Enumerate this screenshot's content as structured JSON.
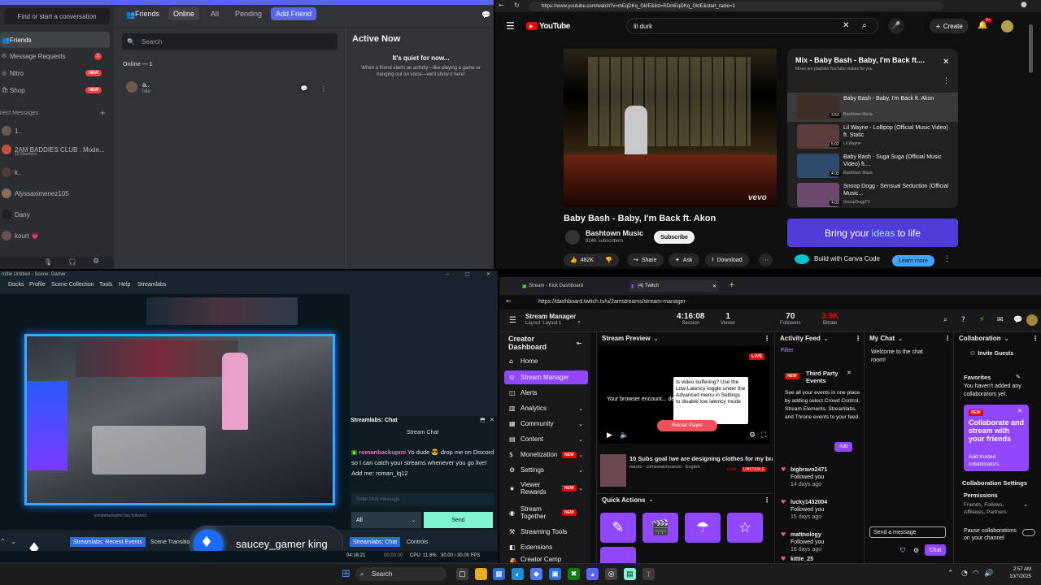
{
  "discord": {
    "find_placeholder": "Find or start a conversation",
    "nav": [
      {
        "label": "Friends"
      },
      {
        "label": "Message Requests",
        "badge": "1"
      },
      {
        "label": "Nitro",
        "badge": "NEW"
      },
      {
        "label": "Shop",
        "badge": "NEW"
      }
    ],
    "dm_header": "irect Messages",
    "dms": [
      {
        "name": "1..",
        "sub": ""
      },
      {
        "name": "2AM BADDIES CLUB . Mode...",
        "sub": "10 Members"
      },
      {
        "name": "k..",
        "sub": ""
      },
      {
        "name": "Alyssaximenez105",
        "sub": ""
      },
      {
        "name": "Dany",
        "sub": ""
      },
      {
        "name": "kourt 💗",
        "sub": ""
      }
    ],
    "tabs": {
      "friends": "Friends",
      "online": "Online",
      "all": "All",
      "pending": "Pending",
      "add": "Add Friend"
    },
    "search_placeholder": "Search",
    "online_count": "Online — 1",
    "friend": {
      "name": "a..",
      "status": "Idle"
    },
    "active_now": {
      "title": "Active Now",
      "quiet": "It's quiet for now...",
      "desc": "When a friend starts an activity—like playing a game or hanging out on voice—we'll show it here!"
    }
  },
  "youtube": {
    "url": "https://www.youtube.com/watch?v=mEqDKq_GkIE&list=RDmEqDKq_GkIE&start_radio=1",
    "logo": "YouTube",
    "search_value": "lil durk",
    "create_label": "Create",
    "notif_count": "9+",
    "video_title": "Baby Bash - Baby, I'm Back ft. Akon",
    "vevo": "vevo",
    "channel": "Bashtown Music",
    "subscribers": "824K subscribers",
    "subscribe": "Subscribe",
    "likes": "482K",
    "share": "Share",
    "ask": "Ask",
    "download": "Download",
    "playlist": {
      "title": "Mix - Baby Bash - Baby, I'm Back ft....",
      "subtitle": "Mixes are playlists YouTube makes for you",
      "items": [
        {
          "title": "Baby Bash - Baby, I'm Back ft. Akon",
          "channel": "Bashtown Music",
          "duration": "3:53"
        },
        {
          "title": "Lil Wayne - Lollipop (Official Music Video) ft. Static",
          "channel": "Lil Wayne",
          "duration": "5:02"
        },
        {
          "title": "Baby Bash - Suga Suga (Official Music Video) ft....",
          "channel": "Bashtown Music",
          "duration": "4:03"
        },
        {
          "title": "Snoop Dogg - Sensual Seduction (Official Music...",
          "channel": "SnoopDoggTV",
          "duration": "4:03"
        }
      ]
    },
    "ad": {
      "text_a": "Bring your ",
      "text_b": "ideas",
      "text_c": " to life",
      "sub": "Build with Canva Code",
      "cta": "Learn more"
    }
  },
  "streamlabs": {
    "title": "rofile Untitled - Scene: Gamer",
    "menu": [
      "Docks",
      "Profile",
      "Scene Collection",
      "Tools",
      "Help",
      "Streamlabs"
    ],
    "chat_title": "Streamlabs: Chat",
    "chat_sub": "Stream Chat",
    "chat_user": "romanbackupmi",
    "chat_msg": "Yo dude 😎 drop me on Discord so I can catch your streams whenever you go live! Add me: roman_lq12",
    "chat_placeholder": "Enter chat message",
    "chat_select": "All",
    "send": "Send",
    "bottom_tabs": [
      "Streamlabs: Recent Events",
      "Scene Transitio",
      "Streamlabs: Chat",
      "Controls"
    ],
    "overlay_name": "saucey_gamer king",
    "status": {
      "time": "04:16:21",
      "rec": "00:00:00",
      "cpu": "CPU: 11.8%",
      "fps": "30.00 / 30.00 FPS"
    },
    "recent_event": "romanbackupmi has followed"
  },
  "twitch": {
    "tabs": [
      {
        "label": "Stream - Kick Dashboard"
      },
      {
        "label": "(4) Twitch"
      }
    ],
    "url": "https://dashboard.twitch.tv/u/2amstreams/stream-manager",
    "page": "Stream Manager",
    "layout": "Layout: Layout 1",
    "stats": [
      {
        "value": "4:16:08",
        "label": "Session"
      },
      {
        "value": "1",
        "label": "Viewer"
      },
      {
        "value": "70",
        "label": "Followers"
      },
      {
        "value": "3.9K",
        "label": "Bitrate"
      }
    ],
    "sidebar_title": "Creator Dashboard",
    "nav": [
      {
        "label": "Home",
        "chev": false,
        "new": false
      },
      {
        "label": "Stream Manager",
        "chev": false,
        "new": false
      },
      {
        "label": "Alerts",
        "chev": false,
        "new": false
      },
      {
        "label": "Analytics",
        "chev": true,
        "new": false
      },
      {
        "label": "Community",
        "chev": true,
        "new": false
      },
      {
        "label": "Content",
        "chev": true,
        "new": false
      },
      {
        "label": "Monetization",
        "chev": true,
        "new": true
      },
      {
        "label": "Settings",
        "chev": true,
        "new": false
      },
      {
        "label": "Viewer Rewards",
        "chev": true,
        "new": true
      },
      {
        "label": "Stream Together",
        "chev": false,
        "new": true
      },
      {
        "label": "Streaming Tools",
        "chev": false,
        "new": false
      },
      {
        "label": "Extensions",
        "chev": false,
        "new": false
      },
      {
        "label": "Creator Camp",
        "chev": false,
        "new": false
      }
    ],
    "new_label": "NEW",
    "preview": {
      "title": "Stream Preview",
      "live": "LIVE",
      "browser_msg": "Your browser encount... decoding the video",
      "tooltip": "Is video buffering? Use the Low Latency toggle under the Advanced menu in Settings to disable low latency mode",
      "reload": "Reload Player",
      "stream_title": "10 Subs goal !we are designing clothes for my brar",
      "tags": [
        "naruto",
        "comewatchnaruto",
        "English"
      ],
      "unstable": "UNSTABLE",
      "live_small": "Live"
    },
    "quick_actions": "Quick Actions",
    "activity": {
      "title": "Activity Feed",
      "filter": "Filter",
      "new": "NEW",
      "third_party": "Third Party Events",
      "desc": "See all your events in one place by adding select Crowd Control, Stream Elements, Streamlabs, and Throne events to your feed.",
      "add": "Add",
      "events": [
        {
          "name": "bigbravo2471",
          "msg": "Followed you",
          "ago": "14 days ago"
        },
        {
          "name": "lucky1432004",
          "msg": "Followed you",
          "ago": "15 days ago"
        },
        {
          "name": "mattnology",
          "msg": "Followed you",
          "ago": "16 days ago"
        },
        {
          "name": "kittie_25",
          "msg": "Followed",
          "ago": ""
        }
      ]
    },
    "chat": {
      "title": "My Chat",
      "welcome": "Welcome to the chat room!",
      "placeholder": "Send a message",
      "button": "Chat"
    },
    "collab": {
      "title": "Collaboration",
      "invite": "Invite Guests",
      "favorites": "Favorites",
      "fav_desc": "You haven't added any collaborators yet.",
      "card_new": "NEW",
      "card_title": "Collaborate and stream with your friends",
      "card_sub": "Add trusted collaborators",
      "settings": "Collaboration Settings",
      "perm_title": "Permissions",
      "perm_desc": "Friends, Follows, Affiliates, Partners",
      "pause_title": "Pause collaborations on your channel"
    }
  },
  "taskbar": {
    "search": "Search",
    "time": "2:57 AM",
    "date": "10/7/2025"
  }
}
